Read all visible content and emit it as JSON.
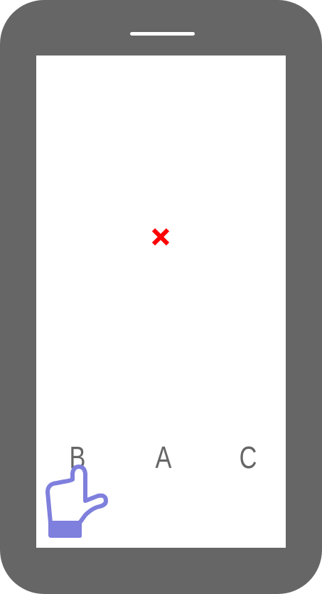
{
  "options": [
    {
      "label": "B"
    },
    {
      "label": "A"
    },
    {
      "label": "C"
    }
  ],
  "colors": {
    "frame": "#666666",
    "target_mark": "#ff0000",
    "hand": "#7f7fdd",
    "text": "#666666"
  },
  "icons": {
    "target": "close-x-icon",
    "pointer": "pointing-hand-icon"
  }
}
